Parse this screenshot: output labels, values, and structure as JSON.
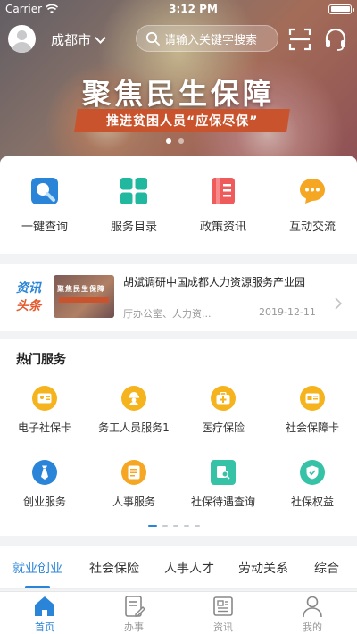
{
  "status_bar": {
    "carrier": "Carrier",
    "time": "3:12 PM"
  },
  "header": {
    "city": "成都市",
    "search_placeholder": "请输入关键字搜索"
  },
  "banner": {
    "title": "聚焦民生保障",
    "subtitle": "推进贫困人员“应保尽保”",
    "slide_count": 2,
    "active_slide": 1
  },
  "quick_actions": [
    {
      "label": "一键查询",
      "icon": "search-icon",
      "color": "#2a84d8"
    },
    {
      "label": "服务目录",
      "icon": "grid-icon",
      "color": "#21b8a0"
    },
    {
      "label": "政策资讯",
      "icon": "document-icon",
      "color": "#ef5a5a"
    },
    {
      "label": "互动交流",
      "icon": "chat-bubble-icon",
      "color": "#f5a623"
    }
  ],
  "news": {
    "tag_line1": "资讯",
    "tag_line2": "头条",
    "thumb_text": "聚焦民生保障",
    "title": "胡斌调研中国成都人力资源服务产业园",
    "source": "厅办公室、人力资...",
    "date": "2019-12-11"
  },
  "hot_services": {
    "title": "热门服务",
    "items": [
      {
        "label": "电子社保卡",
        "icon": "id-card-icon",
        "color": "#f5b31e"
      },
      {
        "label": "务工人员服务1",
        "icon": "worker-icon",
        "color": "#f5b31e"
      },
      {
        "label": "医疗保险",
        "icon": "medical-kit-icon",
        "color": "#f5b31e"
      },
      {
        "label": "社会保障卡",
        "icon": "social-card-icon",
        "color": "#f5b31e"
      },
      {
        "label": "创业服务",
        "icon": "tie-icon",
        "color": "#2a84d8"
      },
      {
        "label": "人事服务",
        "icon": "file-icon",
        "color": "#f5a623"
      },
      {
        "label": "社保待遇查询",
        "icon": "document-search-icon",
        "color": "#36c2a7"
      },
      {
        "label": "社保权益",
        "icon": "shield-check-icon",
        "color": "#36c2a7"
      }
    ],
    "page_count": 5,
    "active_page": 1
  },
  "categories": [
    {
      "label": "就业创业",
      "active": true
    },
    {
      "label": "社会保险",
      "active": false
    },
    {
      "label": "人事人才",
      "active": false
    },
    {
      "label": "劳动关系",
      "active": false
    },
    {
      "label": "综合",
      "active": false
    }
  ],
  "tabbar": [
    {
      "label": "首页",
      "icon": "home-icon",
      "active": true
    },
    {
      "label": "办事",
      "icon": "handle-affairs-icon",
      "active": false
    },
    {
      "label": "资讯",
      "icon": "news-icon",
      "active": false
    },
    {
      "label": "我的",
      "icon": "profile-icon",
      "active": false
    }
  ],
  "colors": {
    "accent": "#2a84d8",
    "banner_ribbon": "#c8532c"
  }
}
